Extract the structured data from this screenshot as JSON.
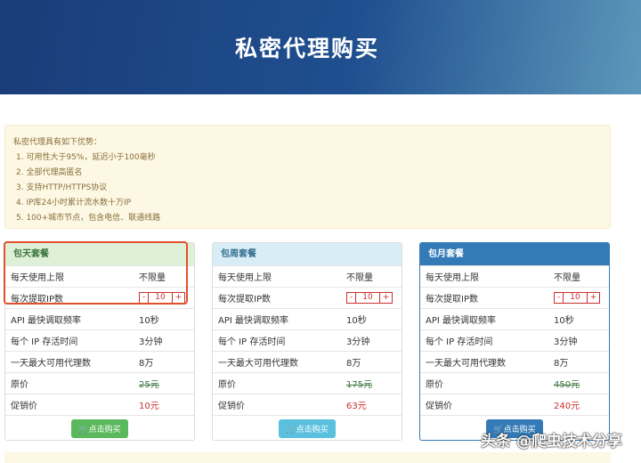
{
  "header": {
    "title": "私密代理购买"
  },
  "advantages": {
    "intro": "私密代理具有如下优势：",
    "items": [
      "1. 可用性大于95%，延迟小于100毫秒",
      "2. 全部代理高匿名",
      "3. 支持HTTP/HTTPS协议",
      "4. IP库24小时累计流水数十万IP",
      "5. 100+城市节点，包含电信、联通线路"
    ]
  },
  "plans": [
    {
      "title": "包天套餐",
      "rows": {
        "limit_k": "每天使用上限",
        "limit_v": "不限量",
        "ip_k": "每次提取IP数",
        "ip_v": "10",
        "api_k": "API 最快调取频率",
        "api_v": "10秒",
        "alive_k": "每个 IP 存活时间",
        "alive_v": "3分钟",
        "max_k": "一天最大可用代理数",
        "max_v": "8万",
        "orig_k": "原价",
        "orig_v": "25元",
        "sale_k": "促销价",
        "sale_v": "10元"
      },
      "buy": "点击购买",
      "color": "#5cb85c",
      "header_bg": "#dff0d8",
      "header_color": "#3c763d"
    },
    {
      "title": "包周套餐",
      "rows": {
        "limit_k": "每天使用上限",
        "limit_v": "不限量",
        "ip_k": "每次提取IP数",
        "ip_v": "10",
        "api_k": "API 最快调取频率",
        "api_v": "10秒",
        "alive_k": "每个 IP 存活时间",
        "alive_v": "3分钟",
        "max_k": "一天最大可用代理数",
        "max_v": "8万",
        "orig_k": "原价",
        "orig_v": "175元",
        "sale_k": "促销价",
        "sale_v": "63元"
      },
      "buy": "点击购买",
      "color": "#5bc0de",
      "header_bg": "#d9edf7",
      "header_color": "#31708f"
    },
    {
      "title": "包月套餐",
      "rows": {
        "limit_k": "每天使用上限",
        "limit_v": "不限量",
        "ip_k": "每次提取IP数",
        "ip_v": "10",
        "api_k": "API 最快调取频率",
        "api_v": "10秒",
        "alive_k": "每个 IP 存活时间",
        "alive_v": "3分钟",
        "max_k": "一天最大可用代理数",
        "max_v": "8万",
        "orig_k": "原价",
        "orig_v": "450元",
        "sale_k": "促销价",
        "sale_v": "240元"
      },
      "buy": "点击购买",
      "color": "#337ab7",
      "header_bg": "#337ab7",
      "header_color": "#ffffff"
    }
  ],
  "stepper": {
    "minus": "-",
    "plus": "+"
  },
  "watermark": "头条 @爬虫技术分享"
}
